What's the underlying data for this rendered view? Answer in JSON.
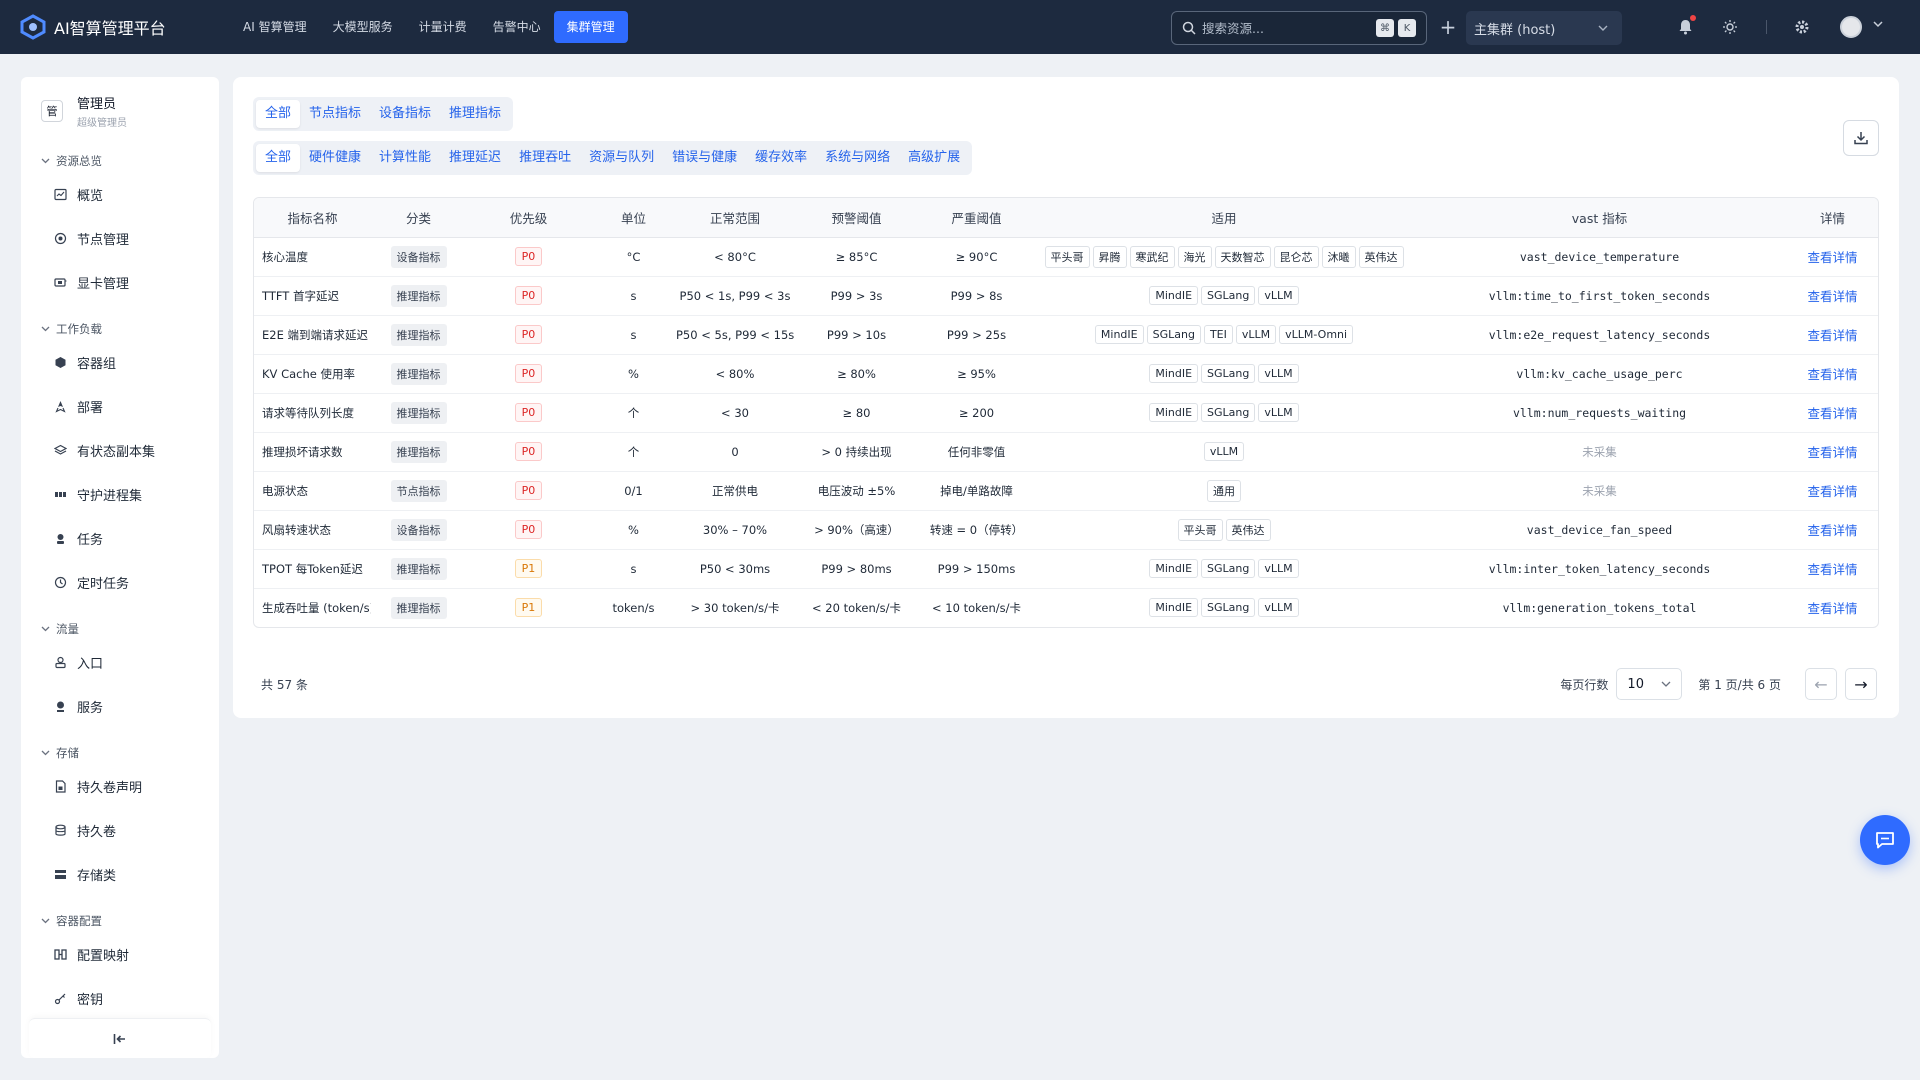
{
  "app": {
    "title": "AI智算管理平台"
  },
  "nav": [
    {
      "label": "AI 智算管理",
      "active": false
    },
    {
      "label": "大模型服务",
      "active": false
    },
    {
      "label": "计量计费",
      "active": false
    },
    {
      "label": "告警中心",
      "active": false
    },
    {
      "label": "集群管理",
      "active": true
    }
  ],
  "search": {
    "placeholder": "搜索资源...",
    "kbd1": "⌘",
    "kbd2": "K"
  },
  "cluster": {
    "value": "主集群 (host)"
  },
  "user": {
    "badge": "管",
    "name": "管理员",
    "role": "超级管理员"
  },
  "sidebar": {
    "sections": [
      {
        "label": "资源总览",
        "items": [
          "概览",
          "节点管理",
          "显卡管理"
        ]
      },
      {
        "label": "工作负载",
        "items": [
          "容器组",
          "部署",
          "有状态副本集",
          "守护进程集",
          "任务",
          "定时任务"
        ]
      },
      {
        "label": "流量",
        "items": [
          "入口",
          "服务"
        ]
      },
      {
        "label": "存储",
        "items": [
          "持久卷声明",
          "持久卷",
          "存储类"
        ]
      },
      {
        "label": "容器配置",
        "items": [
          "配置映射",
          "密钥"
        ]
      }
    ]
  },
  "tabs1": [
    "全部",
    "节点指标",
    "设备指标",
    "推理指标"
  ],
  "tabs2": [
    "全部",
    "硬件健康",
    "计算性能",
    "推理延迟",
    "推理吞吐",
    "资源与队列",
    "错误与健康",
    "缓存效率",
    "系统与网络",
    "高级扩展"
  ],
  "table": {
    "headers": [
      "指标名称",
      "分类",
      "优先级",
      "单位",
      "正常范围",
      "预警阈值",
      "严重阈值",
      "适用",
      "vast 指标",
      "详情"
    ],
    "rows": [
      {
        "name": "核心温度",
        "category": "设备指标",
        "priority": "P0",
        "unit": "°C",
        "normal": "< 80°C",
        "warn": "≥ 85°C",
        "critical": "≥ 90°C",
        "applies": [
          "平头哥",
          "昇腾",
          "寒武纪",
          "海光",
          "天数智芯",
          "昆仑芯",
          "沐曦",
          "英伟达"
        ],
        "metric": "vast_device_temperature",
        "detail": "查看详情"
      },
      {
        "name": "TTFT 首字延迟",
        "category": "推理指标",
        "priority": "P0",
        "unit": "s",
        "normal": "P50 < 1s, P99 < 3s",
        "warn": "P99 > 3s",
        "critical": "P99 > 8s",
        "applies": [
          "MindIE",
          "SGLang",
          "vLLM"
        ],
        "metric": "vllm:time_to_first_token_seconds",
        "detail": "查看详情"
      },
      {
        "name": "E2E 端到端请求延迟",
        "category": "推理指标",
        "priority": "P0",
        "unit": "s",
        "normal": "P50 < 5s, P99 < 15s",
        "warn": "P99 > 10s",
        "critical": "P99 > 25s",
        "applies": [
          "MindIE",
          "SGLang",
          "TEI",
          "vLLM",
          "vLLM-Omni"
        ],
        "metric": "vllm:e2e_request_latency_seconds",
        "detail": "查看详情"
      },
      {
        "name": "KV Cache 使用率",
        "category": "推理指标",
        "priority": "P0",
        "unit": "%",
        "normal": "< 80%",
        "warn": "≥ 80%",
        "critical": "≥ 95%",
        "applies": [
          "MindIE",
          "SGLang",
          "vLLM"
        ],
        "metric": "vllm:kv_cache_usage_perc",
        "detail": "查看详情"
      },
      {
        "name": "请求等待队列长度",
        "category": "推理指标",
        "priority": "P0",
        "unit": "个",
        "normal": "< 30",
        "warn": "≥ 80",
        "critical": "≥ 200",
        "applies": [
          "MindIE",
          "SGLang",
          "vLLM"
        ],
        "metric": "vllm:num_requests_waiting",
        "detail": "查看详情"
      },
      {
        "name": "推理损坏请求数",
        "category": "推理指标",
        "priority": "P0",
        "unit": "个",
        "normal": "0",
        "warn": "> 0 持续出现",
        "critical": "任何非零值",
        "applies": [
          "vLLM"
        ],
        "metric": "未采集",
        "detail": "查看详情"
      },
      {
        "name": "电源状态",
        "category": "节点指标",
        "priority": "P0",
        "unit": "0/1",
        "normal": "正常供电",
        "warn": "电压波动 ±5%",
        "critical": "掉电/单路故障",
        "applies": [
          "通用"
        ],
        "metric": "未采集",
        "detail": "查看详情"
      },
      {
        "name": "风扇转速状态",
        "category": "设备指标",
        "priority": "P0",
        "unit": "%",
        "normal": "30% – 70%",
        "warn": "> 90%（高速）",
        "critical": "转速 = 0（停转）",
        "applies": [
          "平头哥",
          "英伟达"
        ],
        "metric": "vast_device_fan_speed",
        "detail": "查看详情"
      },
      {
        "name": "TPOT 每Token延迟",
        "category": "推理指标",
        "priority": "P1",
        "unit": "s",
        "normal": "P50 < 30ms",
        "warn": "P99 > 80ms",
        "critical": "P99 > 150ms",
        "applies": [
          "MindIE",
          "SGLang",
          "vLLM"
        ],
        "metric": "vllm:inter_token_latency_seconds",
        "detail": "查看详情"
      },
      {
        "name": "生成吞吐量 (token/s)",
        "category": "推理指标",
        "priority": "P1",
        "unit": "token/s",
        "normal": "> 30 token/s/卡",
        "warn": "< 20 token/s/卡",
        "critical": "< 10 token/s/卡",
        "applies": [
          "MindIE",
          "SGLang",
          "vLLM"
        ],
        "metric": "vllm:generation_tokens_total",
        "detail": "查看详情"
      }
    ]
  },
  "footer": {
    "total": "共 57 条",
    "per_page_label": "每页行数",
    "per_page": "10",
    "page_info": "第 1 页/共 6 页",
    "prev": "←",
    "next": "→"
  },
  "colors": {
    "topbar": "#1d2a3f",
    "accent": "#2f6bff",
    "link": "#2563eb",
    "p0": "#dc2626",
    "p1": "#d97706"
  }
}
